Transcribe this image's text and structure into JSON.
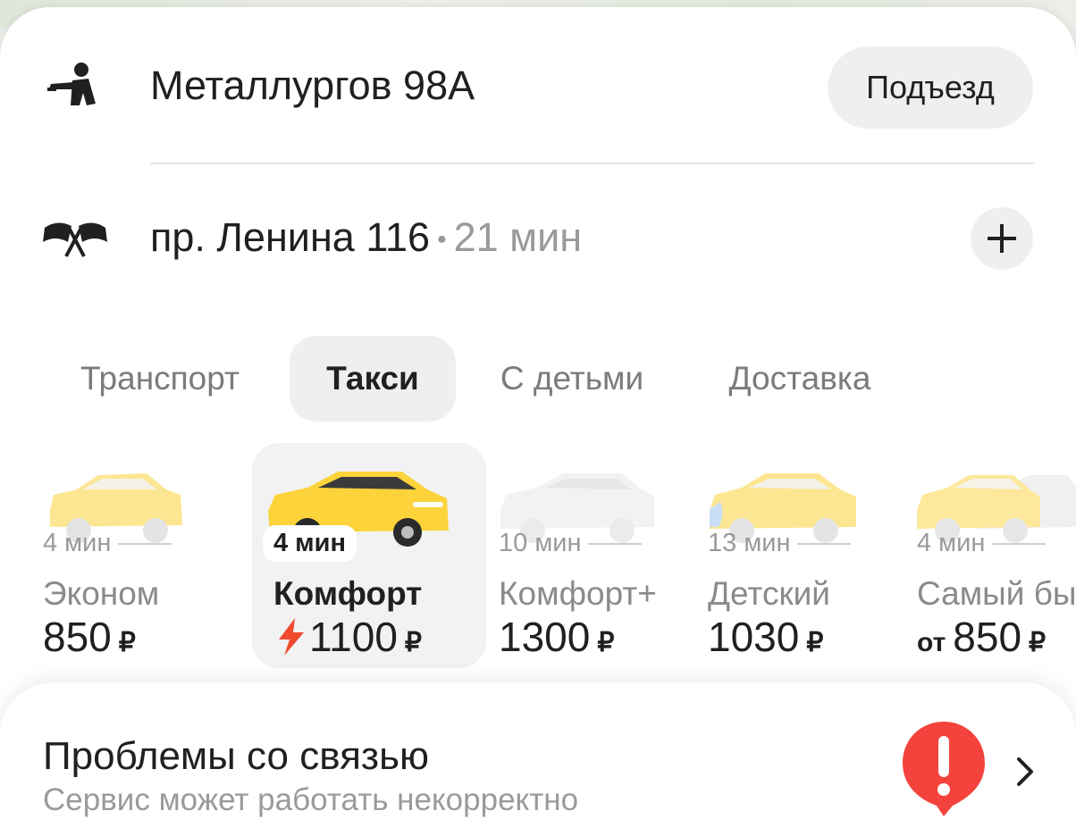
{
  "route": {
    "from": {
      "address": "Металлургов 98А",
      "entrance_label": "Подъезд"
    },
    "to": {
      "address": "пр. Ленина 116",
      "separator": "•",
      "travel_time": "21 мин"
    }
  },
  "tabs": [
    {
      "label": "Транспорт",
      "active": false
    },
    {
      "label": "Такси",
      "active": true
    },
    {
      "label": "С детьми",
      "active": false
    },
    {
      "label": "Доставка",
      "active": false
    }
  ],
  "tariffs": [
    {
      "eta": "4 мин",
      "name": "Эконом",
      "price": "850",
      "currency": "₽",
      "prefix": ""
    },
    {
      "eta": "4 мин",
      "name": "Комфорт",
      "price": "1100",
      "currency": "₽",
      "prefix": "",
      "selected": true,
      "surge": true
    },
    {
      "eta": "10 мин",
      "name": "Комфорт+",
      "price": "1300",
      "currency": "₽",
      "prefix": ""
    },
    {
      "eta": "13 мин",
      "name": "Детский",
      "price": "1030",
      "currency": "₽",
      "prefix": ""
    },
    {
      "eta": "4 мин",
      "name": "Самый бы",
      "price": "850",
      "currency": "₽",
      "prefix": "от"
    }
  ],
  "notice": {
    "title": "Проблемы со связью",
    "subtitle": "Сервис может работать некорректно",
    "icon": "alert-icon"
  },
  "colors": {
    "taxi_yellow": "#fcd33a",
    "surge_red": "#f04a2f",
    "alert_red": "#f4433c"
  }
}
